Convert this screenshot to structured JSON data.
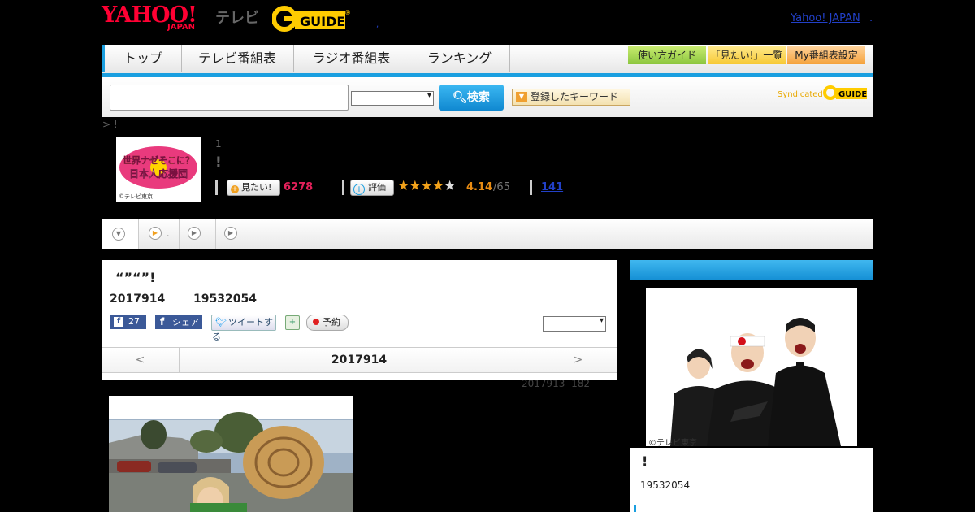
{
  "header": {
    "yahoo_logo": "YAHOO!",
    "japan_logo": "JAPAN",
    "tv_label": "テレビ",
    "gguide_logo": "GUIDE",
    "yahoo_japan_link": "Yahoo! JAPAN",
    "trailing_dot": ".",
    "small_dot": ","
  },
  "nav": {
    "tabs": [
      {
        "label": "トップ"
      },
      {
        "label": "テレビ番組表"
      },
      {
        "label": "ラジオ番組表"
      },
      {
        "label": "ランキング"
      }
    ],
    "guide_buttons": [
      {
        "label": "使い方ガイド"
      },
      {
        "label": "「見たい!」一覧"
      },
      {
        "label": "My番組表設定"
      }
    ]
  },
  "search": {
    "input_value": "",
    "select_value": "",
    "search_button": "検索",
    "keyword_button": "登録したキーワード",
    "syndicated_label": "Syndicated",
    "syndicated_logo": "GUIDE"
  },
  "breadcrumb": "> !",
  "program": {
    "thumbnail_title_line1": "世界ナゼそこに？",
    "thumbnail_title_line2": "日本人応援団",
    "thumbnail_copyright": "©テレビ東京",
    "number": "1",
    "title": "!",
    "want_button": "見たい!",
    "want_count": "6278",
    "rating_button": "評価",
    "rating_value": "4.14",
    "rating_count": "/65",
    "review_link": "141"
  },
  "tabs": {
    "tab2_suffix": "."
  },
  "main": {
    "title": "“”“”!",
    "date": "2017914",
    "code": "19532054",
    "fb_count": "27",
    "share_label": "シェア",
    "tweet_label": "ツイートする",
    "reserve_label": "予約",
    "select_value": "",
    "prev_label": "<",
    "next_label": ">",
    "nav_date": "2017914",
    "sub_date": "2017913",
    "sub_count": "182"
  },
  "side": {
    "header": "",
    "image_copyright": "©テレビ東京",
    "title": "!",
    "code": "19532054"
  },
  "colors": {
    "accent_blue": "#1a9fe0",
    "want_count": "#e3205a",
    "rating": "#e88b12",
    "yahoo_red": "#ff0033",
    "gguide_yellow": "#ffcc00"
  }
}
